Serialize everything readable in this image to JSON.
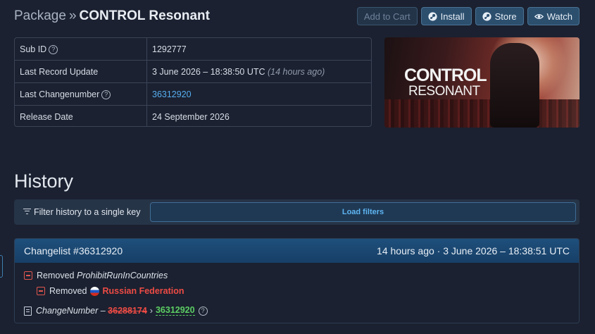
{
  "header": {
    "prefix": "Package",
    "separator": "»",
    "title": "CONTROL Resonant",
    "buttons": {
      "add_to_cart": "Add to Cart",
      "install": "Install",
      "store": "Store",
      "watch": "Watch"
    }
  },
  "info": {
    "rows": [
      {
        "key": "Sub ID",
        "value": "1292777"
      },
      {
        "key": "Last Record Update",
        "value": "3 June 2026 – 18:38:50 UTC",
        "extra": "(14 hours ago)"
      },
      {
        "key": "Last Changenumber",
        "value": "36312920"
      },
      {
        "key": "Release Date",
        "value": "24 September 2026"
      }
    ],
    "help_glyph": "?"
  },
  "cover": {
    "line1": "CONTROL",
    "line2": "RESONANT"
  },
  "history": {
    "title": "History",
    "filter_label": "Filter history to a single key",
    "load_filters": "Load filters"
  },
  "changelist": {
    "title": "Changelist #36312920",
    "time": "14 hours ago · 3 June 2026 – 18:38:51 UTC",
    "removed_label": "Removed",
    "removed_key": "ProhibitRunInCountries",
    "removed_country": "Russian Federation",
    "change_key": "ChangeNumber",
    "dash": "–",
    "old_value": "36288174",
    "arrow": "›",
    "new_value": "36312920"
  },
  "colors": {
    "background": "#1b2130",
    "accent": "#56aef0",
    "removed": "#ee4b45",
    "added": "#5ccf63"
  }
}
